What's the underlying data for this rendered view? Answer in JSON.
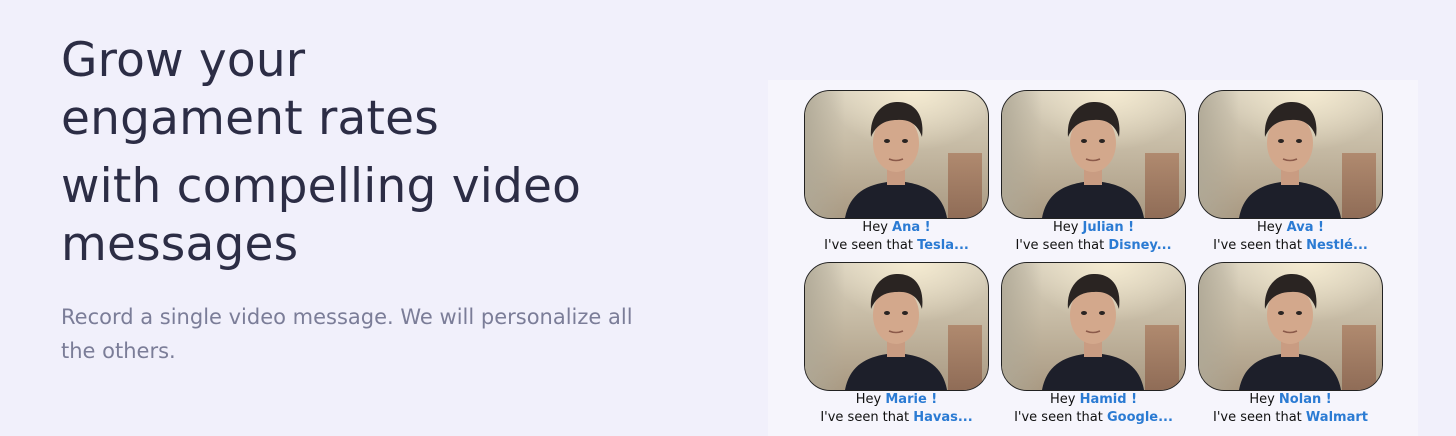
{
  "hero": {
    "headline_line1": "Grow your",
    "headline_line2": "engament rates",
    "headline_line3": "with compelling video",
    "headline_line4": "messages",
    "subtitle": "Record a single video message. We will personalize all the others."
  },
  "videos": [
    {
      "hey": "Hey",
      "name": "Ana !",
      "seen": "I've seen that",
      "company": "Tesla..."
    },
    {
      "hey": "Hey",
      "name": "Julian !",
      "seen": "I've seen that",
      "company": "Disney..."
    },
    {
      "hey": "Hey",
      "name": "Ava !",
      "seen": "I've seen that",
      "company": "Nestlé..."
    },
    {
      "hey": "Hey",
      "name": "Marie !",
      "seen": "I've seen that",
      "company": "Havas..."
    },
    {
      "hey": "Hey",
      "name": "Hamid !",
      "seen": "I've seen that",
      "company": "Google..."
    },
    {
      "hey": "Hey",
      "name": "Nolan !",
      "seen": "I've seen that",
      "company": "Walmart"
    }
  ],
  "colors": {
    "background": "#f1f0fb",
    "headline": "#2c2d45",
    "subtitle": "#7b7d98",
    "highlight": "#2b7bd3"
  }
}
